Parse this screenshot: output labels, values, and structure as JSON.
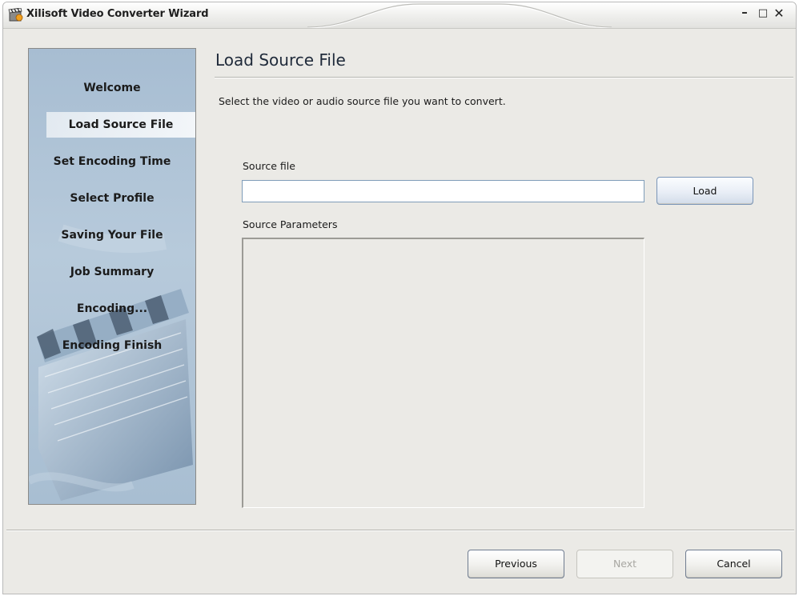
{
  "window": {
    "title": "Xilisoft Video Converter Wizard",
    "controls": {
      "minimize": "–",
      "maximize": "□",
      "close": "✕"
    }
  },
  "sidebar": {
    "steps": [
      {
        "label": "Welcome",
        "active": false
      },
      {
        "label": "Load Source File",
        "active": true
      },
      {
        "label": "Set Encoding Time",
        "active": false
      },
      {
        "label": "Select Profile",
        "active": false
      },
      {
        "label": "Saving Your File",
        "active": false
      },
      {
        "label": "Job Summary",
        "active": false
      },
      {
        "label": "Encoding...",
        "active": false
      },
      {
        "label": "Encoding Finish",
        "active": false
      }
    ]
  },
  "main": {
    "heading": "Load Source File",
    "instructions": "Select the video or audio source file you want to convert.",
    "source_file": {
      "label": "Source file",
      "value": "",
      "load_button": "Load"
    },
    "source_parameters": {
      "label": "Source Parameters"
    }
  },
  "footer": {
    "previous": "Previous",
    "next": "Next",
    "cancel": "Cancel"
  },
  "colors": {
    "window_bg": "#ebeae6",
    "sidebar_bg": "#a7bdd2",
    "input_border": "#7f9db9"
  }
}
